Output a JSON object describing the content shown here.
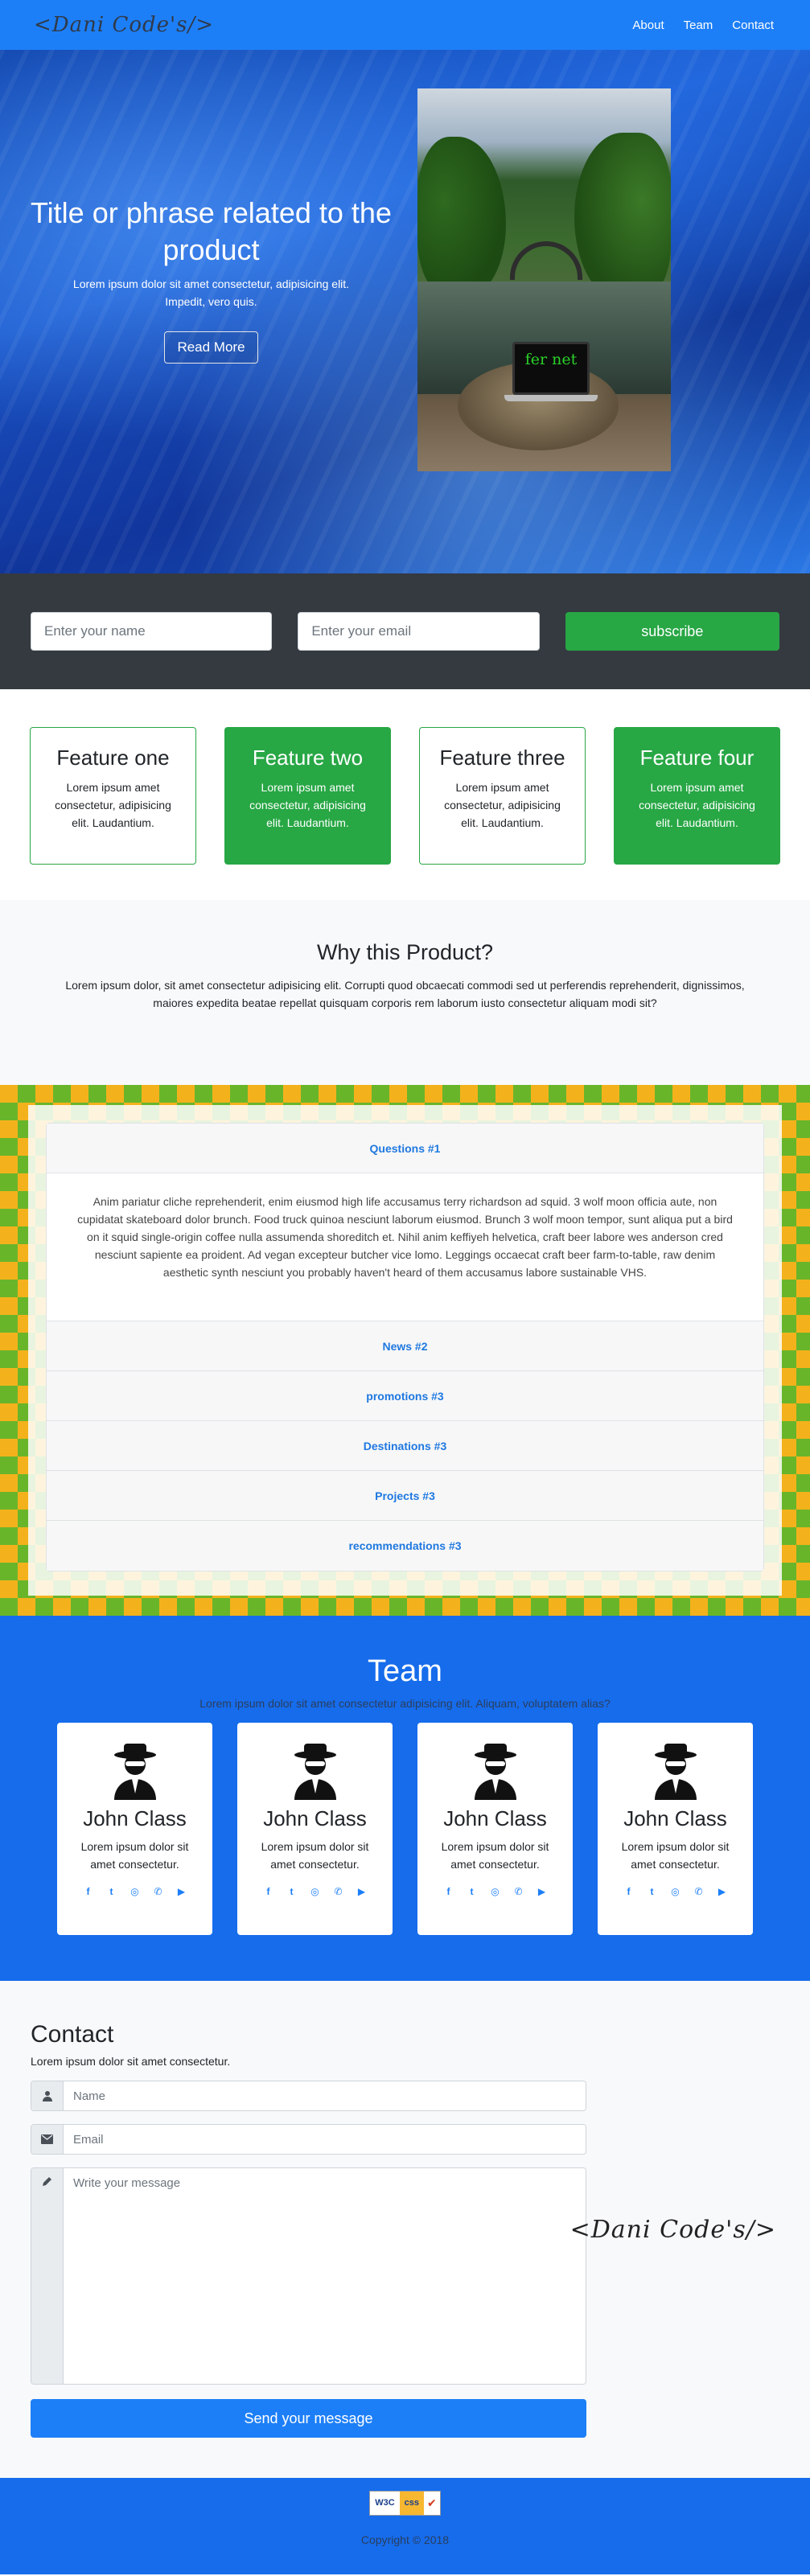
{
  "nav": {
    "logo": "<Dani Code's/>",
    "links": [
      "About",
      "Team",
      "Contact"
    ]
  },
  "hero": {
    "title": "Title or phrase related to the product",
    "subtitle": "Lorem ipsum dolor sit amet consectetur, adipisicing elit. Impedit, vero quis.",
    "button": "Read More",
    "laptop_text": "fer net"
  },
  "subscribe": {
    "name_placeholder": "Enter your name",
    "email_placeholder": "Enter your email",
    "button": "subscribe"
  },
  "features": [
    {
      "title": "Feature one",
      "text": "Lorem ipsum amet consectetur, adipisicing elit. Laudantium."
    },
    {
      "title": "Feature two",
      "text": "Lorem ipsum amet consectetur, adipisicing elit. Laudantium."
    },
    {
      "title": "Feature three",
      "text": "Lorem ipsum amet consectetur, adipisicing elit. Laudantium."
    },
    {
      "title": "Feature four",
      "text": "Lorem ipsum amet consectetur, adipisicing elit. Laudantium."
    }
  ],
  "why": {
    "title": "Why this Product?",
    "text": "Lorem ipsum dolor, sit amet consectetur adipisicing elit. Corrupti quod obcaecati commodi sed ut perferendis reprehenderit, dignissimos, maiores expedita beatae repellat quisquam corporis rem laborum iusto consectetur aliquam modi sit?"
  },
  "accordion": {
    "items": [
      "Questions #1",
      "News #2",
      "promotions #3",
      "Destinations #3",
      "Projects #3",
      "recommendations #3"
    ],
    "body": "Anim pariatur cliche reprehenderit, enim eiusmod high life accusamus terry richardson ad squid. 3 wolf moon officia aute, non cupidatat skateboard dolor brunch. Food truck quinoa nesciunt laborum eiusmod. Brunch 3 wolf moon tempor, sunt aliqua put a bird on it squid single-origin coffee nulla assumenda shoreditch et. Nihil anim keffiyeh helvetica, craft beer labore wes anderson cred nesciunt sapiente ea proident. Ad vegan excepteur butcher vice lomo. Leggings occaecat craft beer farm-to-table, raw denim aesthetic synth nesciunt you probably haven't heard of them accusamus labore sustainable VHS."
  },
  "team": {
    "title": "Team",
    "subtitle": "Lorem ipsum dolor sit amet consectetur adipisicing elit. Aliquam, voluptatem alias?",
    "members": [
      {
        "name": "John Class",
        "text": "Lorem ipsum dolor sit amet consectetur."
      },
      {
        "name": "John Class",
        "text": "Lorem ipsum dolor sit amet consectetur."
      },
      {
        "name": "John Class",
        "text": "Lorem ipsum dolor sit amet consectetur."
      },
      {
        "name": "John Class",
        "text": "Lorem ipsum dolor sit amet consectetur."
      }
    ],
    "social_icons": [
      "facebook-icon",
      "twitter-icon",
      "instagram-icon",
      "whatsapp-icon",
      "youtube-icon"
    ]
  },
  "contact": {
    "title": "Contact",
    "subtitle": "Lorem ipsum dolor sit amet consectetur.",
    "name_placeholder": "Name",
    "email_placeholder": "Email",
    "message_placeholder": "Write your message",
    "button": "Send your message",
    "logo": "<Dani Code's/>"
  },
  "footer": {
    "badge": [
      "W3C",
      "css",
      "✔"
    ],
    "copyright": "Copyright © 2018"
  },
  "colors": {
    "primary": "#1d7ff7",
    "success": "#28a745",
    "dark": "#343a40",
    "team_bg": "#166ceb"
  }
}
